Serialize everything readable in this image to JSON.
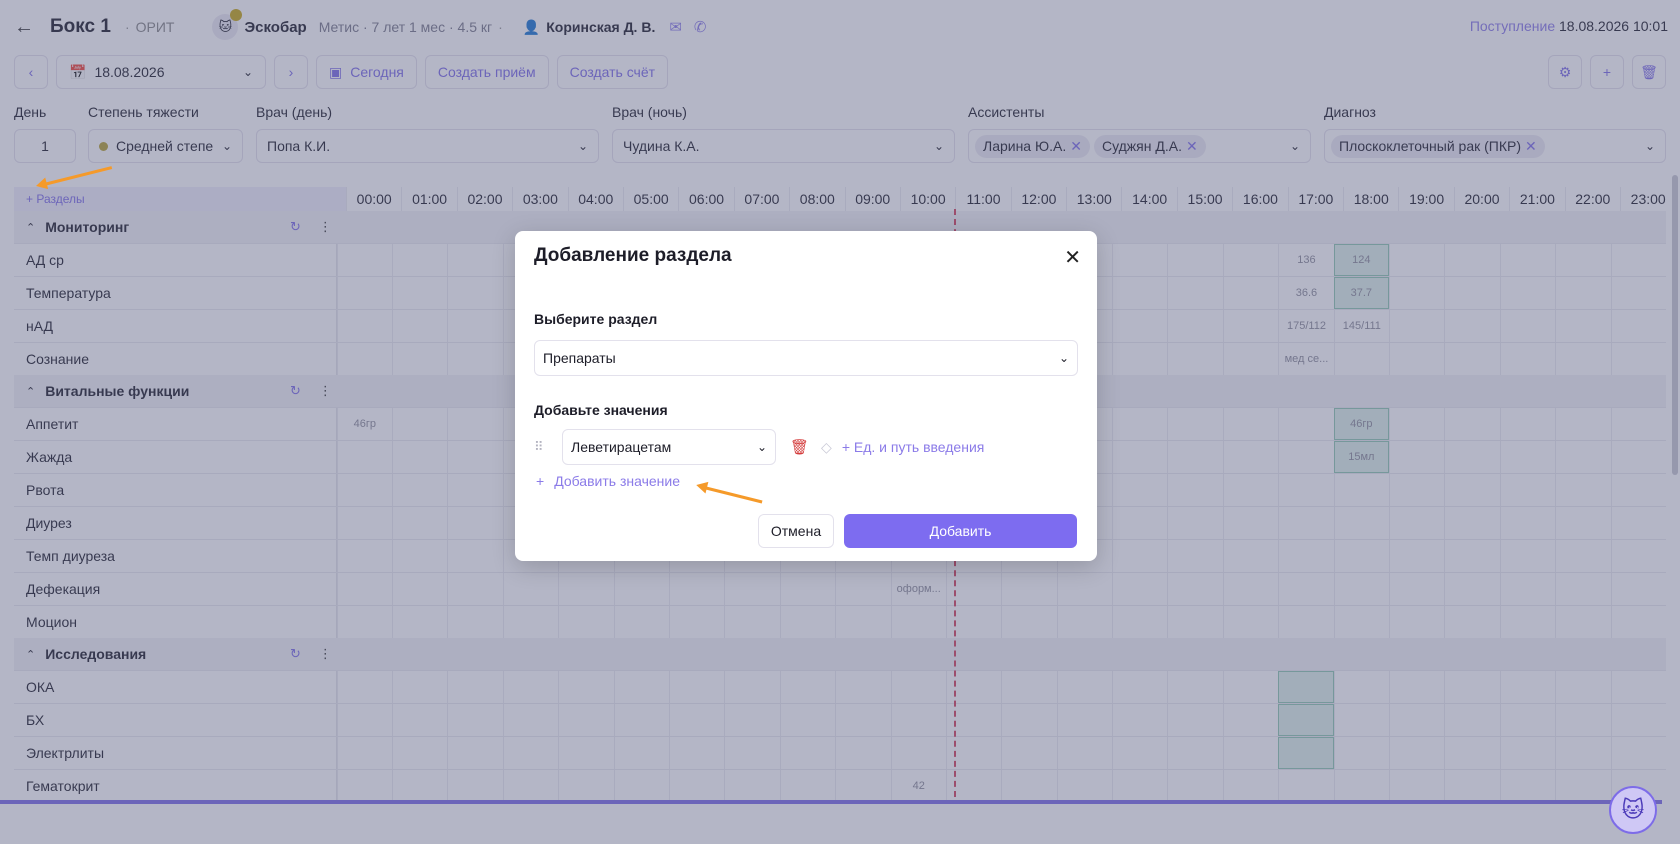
{
  "header": {
    "title": "Бокс 1",
    "department": "ОРИТ",
    "pet_name": "Эскобар",
    "pet_info": "Метис · 7 лет 1 мес · 4.5 кг",
    "owner": "Коринская Д. В.",
    "admission_label": "Поступление",
    "admission_value": "18.08.2026 10:01"
  },
  "toolbar": {
    "date": "18.08.2026",
    "today": "Сегодня",
    "create_appointment": "Создать приём",
    "create_invoice": "Создать счёт"
  },
  "filters": {
    "day_label": "День",
    "day_value": "1",
    "severity_label": "Степень тяжести",
    "severity_value": "Средней степе",
    "doctor_day_label": "Врач (день)",
    "doctor_day_value": "Попа К.И.",
    "doctor_night_label": "Врач (ночь)",
    "doctor_night_value": "Чудина К.А.",
    "assistants_label": "Ассистенты",
    "assistants": [
      "Ларина Ю.А.",
      "Суджян Д.А."
    ],
    "diagnosis_label": "Диагноз",
    "diagnosis": "Плоскоклеточный рак (ПКР)"
  },
  "grid": {
    "sections_label": "+ Разделы",
    "hours": [
      "00:00",
      "01:00",
      "02:00",
      "03:00",
      "04:00",
      "05:00",
      "06:00",
      "07:00",
      "08:00",
      "09:00",
      "10:00",
      "11:00",
      "12:00",
      "13:00",
      "14:00",
      "15:00",
      "16:00",
      "17:00",
      "18:00",
      "19:00",
      "20:00",
      "21:00",
      "22:00",
      "23:00"
    ],
    "groups": [
      {
        "name": "Мониторинг"
      },
      {
        "name": "Витальные функции"
      },
      {
        "name": "Исследования"
      }
    ],
    "rows": {
      "ad": {
        "name": "АД ср",
        "v17": "136",
        "v18": "124"
      },
      "temp": {
        "name": "Температура",
        "v17": "36.6",
        "v18": "37.7"
      },
      "nad": {
        "name": "нАД",
        "v17": "175/112",
        "v18": "145/111"
      },
      "consc": {
        "name": "Сознание",
        "v17": "мед се..."
      },
      "appetite": {
        "name": "Аппетит",
        "v00": "46гр",
        "v18": "46гр"
      },
      "thirst": {
        "name": "Жажда",
        "v18": "15мл"
      },
      "vomit": {
        "name": "Рвота"
      },
      "diuresis": {
        "name": "Диурез"
      },
      "diuresis_rate": {
        "name": "Темп диуреза"
      },
      "defecation": {
        "name": "Дефекация",
        "v10": "оформ..."
      },
      "motion": {
        "name": "Моцион"
      },
      "oka": {
        "name": "ОКА"
      },
      "bh": {
        "name": "БХ"
      },
      "electrolytes": {
        "name": "Электрлиты"
      },
      "hematocrit": {
        "name": "Гематокрит",
        "v10": "42"
      }
    }
  },
  "modal": {
    "title": "Добавление раздела",
    "select_label": "Выберите раздел",
    "select_value": "Препараты",
    "values_label": "Добавьте значения",
    "value_item": "Леветирацетам",
    "unit_link": "+ Ед. и путь введения",
    "add_value": "Добавить значение",
    "cancel": "Отмена",
    "submit": "Добавить"
  },
  "colors": {
    "accent": "#7d6cf0",
    "now_line": "#d4425e",
    "annotation": "#f59a2a"
  }
}
